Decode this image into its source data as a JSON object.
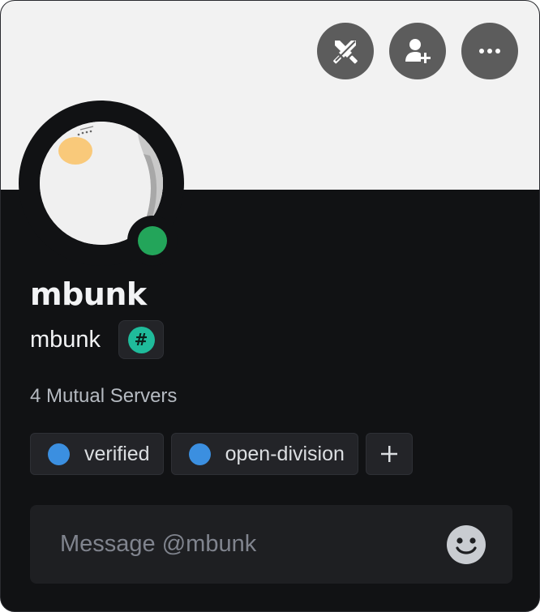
{
  "profile": {
    "display_name": "mbunk",
    "username": "mbunk",
    "badge_symbol": "#",
    "mutual_servers": "4 Mutual Servers",
    "status": "online"
  },
  "actions": {
    "items": [
      {
        "name": "swords-icon"
      },
      {
        "name": "add-friend-icon"
      },
      {
        "name": "more-options-icon"
      }
    ]
  },
  "roles": [
    {
      "label": "verified",
      "color": "#3b8fe0"
    },
    {
      "label": "open-division",
      "color": "#3b8fe0"
    }
  ],
  "add_role_label": "+",
  "message": {
    "placeholder": "Message @mbunk",
    "value": ""
  },
  "colors": {
    "banner": "#f2f2f2",
    "card_bg": "#111214",
    "status_online": "#23a55a",
    "badge": "#1fbb9b"
  }
}
